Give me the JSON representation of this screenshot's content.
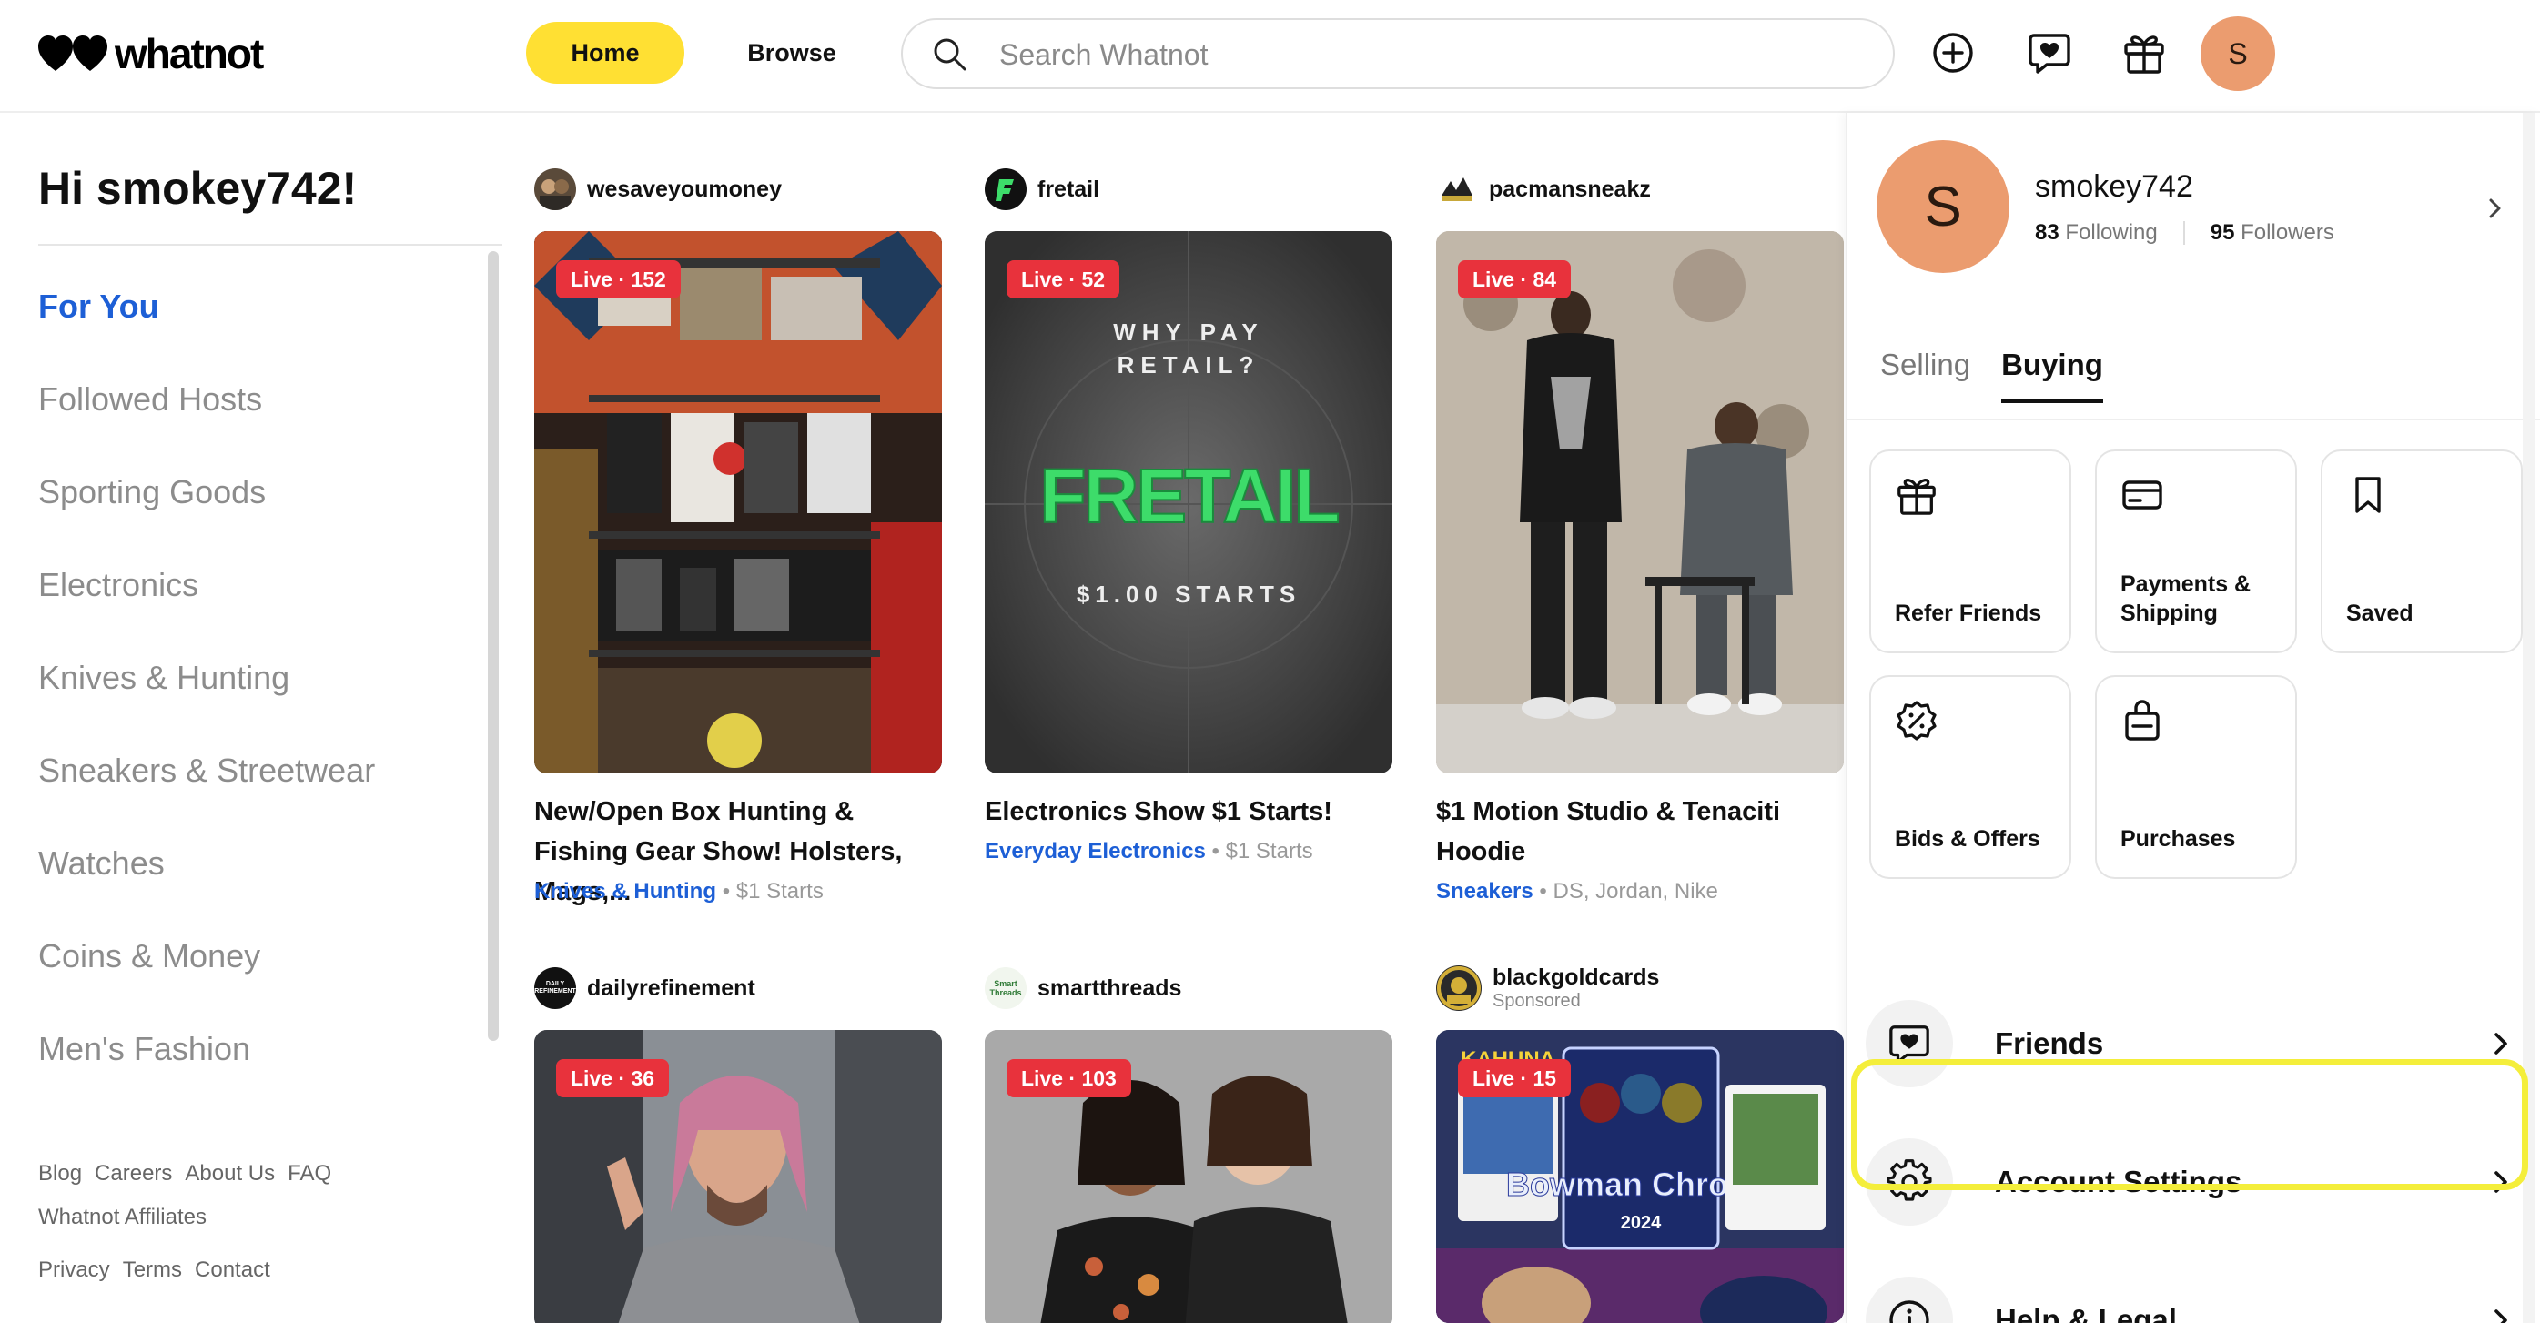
{
  "header": {
    "logo_text": "whatnot",
    "home_label": "Home",
    "browse_label": "Browse",
    "search_placeholder": "Search Whatnot",
    "avatar_initial": "S"
  },
  "sidebar": {
    "greeting": "Hi smokey742!",
    "categories": [
      {
        "label": "For You",
        "active": true
      },
      {
        "label": "Followed Hosts"
      },
      {
        "label": "Sporting Goods"
      },
      {
        "label": "Electronics"
      },
      {
        "label": "Knives & Hunting"
      },
      {
        "label": "Sneakers & Streetwear"
      },
      {
        "label": "Watches"
      },
      {
        "label": "Coins & Money"
      },
      {
        "label": "Men's Fashion"
      }
    ],
    "footer_links": [
      "Blog",
      "Careers",
      "About Us",
      "FAQ",
      "Whatnot Affiliates"
    ],
    "footer_links2": [
      "Privacy",
      "Terms",
      "Contact"
    ]
  },
  "feed": {
    "cards": [
      {
        "host": "wesaveyoumoney",
        "live": "Live · 152",
        "title": "New/Open Box Hunting & Fishing Gear Show! Holsters, Mags,...",
        "tag": "Knives & Hunting",
        "meta": "$1 Starts"
      },
      {
        "host": "fretail",
        "live": "Live · 52",
        "title": "Electronics Show $1 Starts!",
        "tag": "Everyday Electronics",
        "meta": "$1 Starts",
        "thumb_text1": "WHY PAY",
        "thumb_text2": "RETAIL?",
        "thumb_brand": "FRETAIL",
        "thumb_text3": "$1.00 STARTS"
      },
      {
        "host": "pacmansneakz",
        "live": "Live · 84",
        "title": "$1 Motion Studio & Tenaciti Hoodie",
        "tag": "Sneakers",
        "meta": "DS, Jordan, Nike"
      },
      {
        "host": "dailyrefinement",
        "host_avatar_text": "DAILY REFINEMENT",
        "live": "Live · 36"
      },
      {
        "host": "smartthreads",
        "host_avatar_text": "Smart Threads",
        "live": "Live · 103"
      },
      {
        "host": "blackgoldcards",
        "host_sub": "Sponsored",
        "live": "Live · 15",
        "thumb_text": "Bowman Chrome",
        "thumb_year": "2024",
        "thumb_text_b": "KAHUNA"
      }
    ]
  },
  "panel": {
    "avatar_initial": "S",
    "username": "smokey742",
    "following_count": "83",
    "following_label": "Following",
    "followers_count": "95",
    "followers_label": "Followers",
    "tabs": [
      "Selling",
      "Buying"
    ],
    "tiles": [
      {
        "label": "Refer Friends",
        "icon": "gift-icon"
      },
      {
        "label": "Payments & Shipping",
        "icon": "credit-card-icon"
      },
      {
        "label": "Saved",
        "icon": "bookmark-icon"
      },
      {
        "label": "Bids & Offers",
        "icon": "percent-badge-icon"
      },
      {
        "label": "Purchases",
        "icon": "shopping-bag-icon"
      }
    ],
    "rows": [
      {
        "label": "Friends",
        "icon": "heart-chat-icon"
      },
      {
        "label": "Account Settings",
        "icon": "gear-icon"
      },
      {
        "label": "Help & Legal",
        "icon": "info-icon"
      }
    ]
  },
  "colors": {
    "accent_yellow": "#ffe033",
    "link_blue": "#1d5fd6",
    "live_red": "#e8323c",
    "avatar_orange": "#eb9c6f",
    "highlight_yellow": "#f4ee3b"
  }
}
